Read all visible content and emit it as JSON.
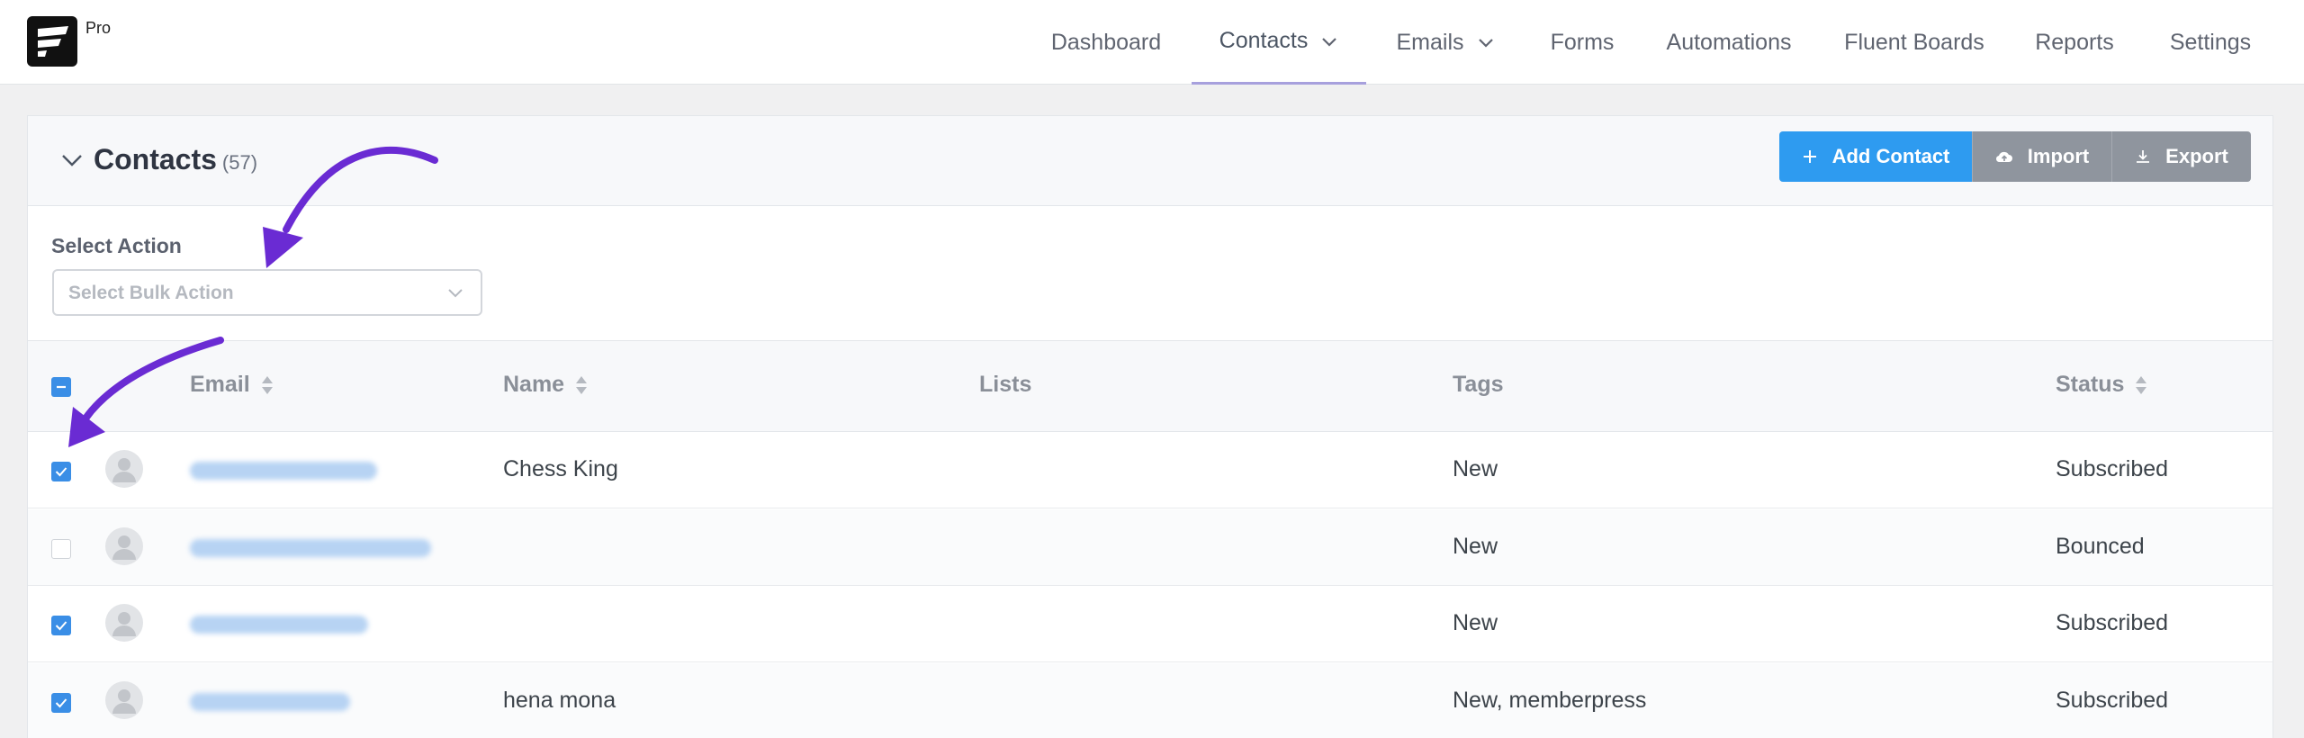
{
  "brand": {
    "badge": "Pro"
  },
  "nav": [
    {
      "label": "Dashboard",
      "active": false,
      "dropdown": false
    },
    {
      "label": "Contacts",
      "active": true,
      "dropdown": true
    },
    {
      "label": "Emails",
      "active": false,
      "dropdown": true
    },
    {
      "label": "Forms",
      "active": false,
      "dropdown": false
    },
    {
      "label": "Automations",
      "active": false,
      "dropdown": false
    },
    {
      "label": "Fluent Boards",
      "active": false,
      "dropdown": false
    },
    {
      "label": "Reports",
      "active": false,
      "dropdown": false
    },
    {
      "label": "Settings",
      "active": false,
      "dropdown": false
    }
  ],
  "page": {
    "title": "Contacts",
    "count": "(57)",
    "buttons": {
      "add": "Add Contact",
      "import": "Import",
      "export": "Export"
    }
  },
  "bulk": {
    "label": "Select Action",
    "placeholder": "Select Bulk Action"
  },
  "table": {
    "headers": {
      "email": "Email",
      "name": "Name",
      "lists": "Lists",
      "tags": "Tags",
      "status": "Status"
    },
    "rows": [
      {
        "checked": true,
        "name": "Chess King",
        "lists": "",
        "tags": "New",
        "status": "Subscribed"
      },
      {
        "checked": false,
        "name": "",
        "lists": "",
        "tags": "New",
        "status": "Bounced"
      },
      {
        "checked": true,
        "name": "",
        "lists": "",
        "tags": "New",
        "status": "Subscribed"
      },
      {
        "checked": true,
        "name": "hena mona",
        "lists": "",
        "tags": "New, memberpress",
        "status": "Subscribed"
      }
    ]
  },
  "colors": {
    "accent": "#2e9bf0",
    "checkbox": "#3a8ee6",
    "annotation": "#6a2bd3",
    "nav_active_underline": "#a7a0dd"
  }
}
